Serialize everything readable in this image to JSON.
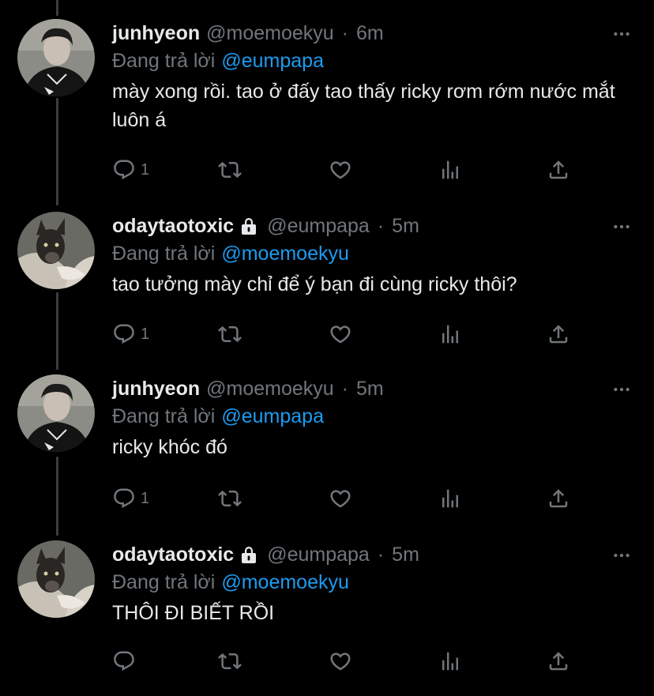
{
  "colors": {
    "background": "#000000",
    "text": "#e7e9ea",
    "muted": "#71767b",
    "accent": "#1d9bf0",
    "thread_line": "#3a3d41"
  },
  "tweets": [
    {
      "name": "junhyeon",
      "handle": "@moemoekyu",
      "time": "6m",
      "locked": false,
      "reply_prefix": "Đang trả lời",
      "reply_to": "@eumpapa",
      "text": "mày xong rồi. tao ở đấy tao thấy ricky rơm rớm nước mắt luôn á",
      "reply_count": "1",
      "avatar": "person-avatar"
    },
    {
      "name": "odaytaotoxic",
      "handle": "@eumpapa",
      "time": "5m",
      "locked": true,
      "reply_prefix": "Đang trả lời",
      "reply_to": "@moemoekyu",
      "text": "tao tưởng mày chỉ để ý bạn đi cùng ricky thôi?",
      "reply_count": "1",
      "avatar": "dog-avatar"
    },
    {
      "name": "junhyeon",
      "handle": "@moemoekyu",
      "time": "5m",
      "locked": false,
      "reply_prefix": "Đang trả lời",
      "reply_to": "@eumpapa",
      "text": "ricky khóc đó",
      "reply_count": "1",
      "avatar": "person-avatar"
    },
    {
      "name": "odaytaotoxic",
      "handle": "@eumpapa",
      "time": "5m",
      "locked": true,
      "reply_prefix": "Đang trả lời",
      "reply_to": "@moemoekyu",
      "text": "THÔI ĐI BIẾT RỒI",
      "reply_count": "",
      "avatar": "dog-avatar"
    }
  ],
  "icons": {
    "reply": "reply-icon",
    "retweet": "retweet-icon",
    "like": "like-icon",
    "analytics": "analytics-icon",
    "share": "share-icon",
    "more": "more-icon",
    "lock": "lock-icon"
  }
}
